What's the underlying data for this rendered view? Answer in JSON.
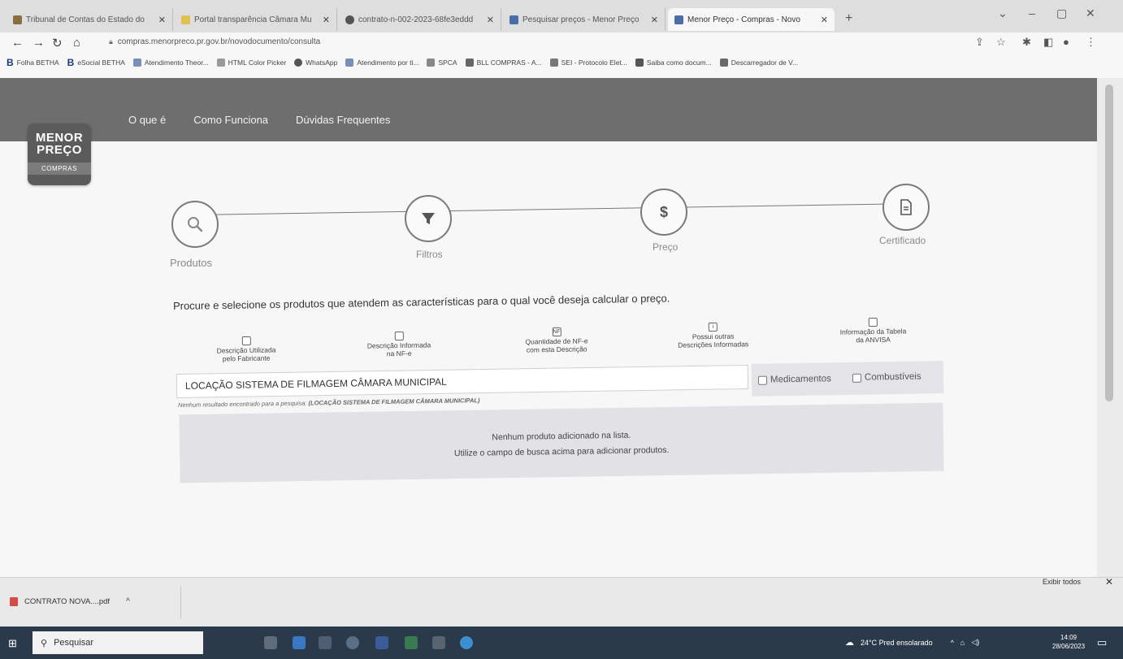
{
  "browser": {
    "tabs": [
      {
        "title": "Tribunal de Contas do Estado do",
        "favicon_color": "#8c6d3f"
      },
      {
        "title": "Portal transparência Câmara Mu",
        "favicon_color": "#e0c050"
      },
      {
        "title": "contrato-n-002-2023-68fe3eddd",
        "favicon_color": "#555555"
      },
      {
        "title": "Pesquisar preços - Menor Preço",
        "favicon_color": "#4a6ea8"
      },
      {
        "title": "Menor Preço - Compras - Novo",
        "favicon_color": "#4a6ea8"
      }
    ],
    "new_tab": "+",
    "window_controls": {
      "minimize": "–",
      "maximize": "▢",
      "close": "✕",
      "tab_search": "⌄"
    },
    "url": "compras.menorpreco.pr.gov.br/novodocumento/consulta",
    "bookmarks": [
      "Folha BETHA",
      "eSocial BETHA",
      "Atendimento Theor...",
      "HTML Color Picker",
      "WhatsApp",
      "Atendimento por ti...",
      "SPCA",
      "BLL COMPRAS - A...",
      "SEI - Protocolo Elet...",
      "Saiba como docum...",
      "Descarregador de V..."
    ]
  },
  "site": {
    "nav": [
      "O que é",
      "Como Funciona",
      "Dúvidas Frequentes"
    ],
    "logo": {
      "line1": "MENOR",
      "line2": "PREÇO",
      "line3": "COMPRAS"
    }
  },
  "steps": [
    {
      "label": "Produtos",
      "icon": "search-icon"
    },
    {
      "label": "Filtros",
      "icon": "filter-icon"
    },
    {
      "label": "Preço",
      "icon": "dollar-icon",
      "symbol": "$"
    },
    {
      "label": "Certificado",
      "icon": "document-icon"
    }
  ],
  "search": {
    "instruction": "Procure e selecione os produtos que atendem as características para o qual você deseja calcular o preço.",
    "columns": [
      {
        "line1": "Descrição Utilizada",
        "line2": "pelo Fabricante",
        "box": ""
      },
      {
        "line1": "Descrição Informada",
        "line2": "na NF-e",
        "box": ""
      },
      {
        "line1": "Quantidade de NF-e",
        "line2": "com esta Descrição",
        "box": "NF"
      },
      {
        "line1": "Possui outras",
        "line2": "Descrições Informadas",
        "box": "i"
      },
      {
        "line1": "Informação da Tabela",
        "line2": "da ANVISA",
        "box": ""
      }
    ],
    "input_value": "LOCAÇÃO SISTEMA DE FILMAGEM CÂMARA MUNICIPAL",
    "filters": {
      "medicamentos": "Medicamentos",
      "combustiveis": "Combustíveis"
    },
    "no_result_prefix": "Nenhum resultado encontrado para a pesquisa: ",
    "no_result_term": "(LOCAÇÃO SISTEMA DE FILMAGEM CÂMARA MUNICIPAL)",
    "empty_line1": "Nenhum produto adicionado na lista.",
    "empty_line2": "Utilize o campo de busca acima para adicionar produtos."
  },
  "download_bar": {
    "file": "CONTRATO NOVA....pdf",
    "show_all": "Exibir todos",
    "close": "✕"
  },
  "taskbar": {
    "search_placeholder": "Pesquisar",
    "weather": "24°C  Pred ensolarado",
    "time": "14:09",
    "date": "28/06/2023"
  }
}
